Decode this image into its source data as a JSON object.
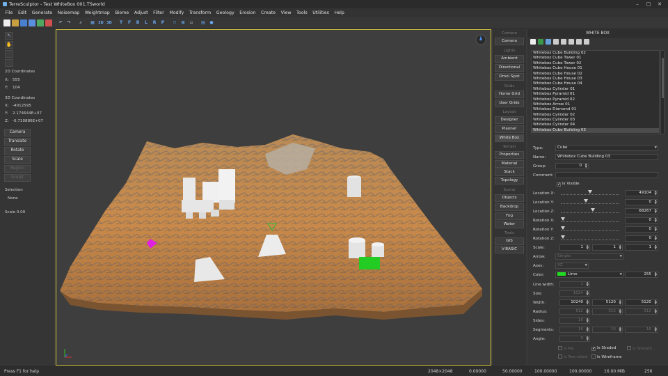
{
  "window": {
    "title": "TerreSculptor - Test WhiteBox 001.TSworld",
    "minimize": "–",
    "maximize": "□",
    "close": "✕"
  },
  "menu": [
    "File",
    "Edit",
    "Generate",
    "Noisemap",
    "Weightmap",
    "Biome",
    "Adjust",
    "Filter",
    "Modify",
    "Transform",
    "Geology",
    "Erosion",
    "Create",
    "View",
    "Tools",
    "Utilities",
    "Help"
  ],
  "toolbar": {
    "icons": [
      "new-file-icon",
      "open-icon",
      "save-icon",
      "save-as-icon",
      "import-icon",
      "export-icon",
      "undo-icon",
      "redo-icon",
      "zoom-icon",
      "grid-icon",
      "view-3d-icon",
      "view-3d-alt-icon",
      "top-view-icon",
      "front-view-icon",
      "back-view-icon",
      "left-view-icon",
      "right-view-icon",
      "perspective-view-icon",
      "snap-icon",
      "layout-icon",
      "wireframe-icon",
      "layers-icon",
      "globe-icon"
    ],
    "letters": [
      "T",
      "F",
      "B",
      "L",
      "R",
      "P"
    ]
  },
  "left": {
    "coords2d_label": "2D Coordinates",
    "x_label": "X:",
    "x_value": "555",
    "y_label": "Y:",
    "y_value": "104",
    "coords3d_label": "3D Coordinates",
    "x3_label": "X:",
    "x3_value": "-4012595",
    "y3_label": "Y:",
    "y3_value": "2.174644E+07",
    "z3_label": "Z:",
    "z3_value": "-6.710886E+07",
    "buttons": [
      "Camera",
      "Translate",
      "Rotate",
      "Scale",
      "Region",
      "Sculpt"
    ],
    "selection_label": "Selection",
    "selection_value": "None",
    "scale_text": "Scale 0.00"
  },
  "middle": {
    "camera_header": "Camera",
    "camera_btn": "Camera",
    "lights_header": "Lights",
    "ambient_btn": "Ambient",
    "directional_btn": "Directional",
    "omni_btn": "Omni Spot",
    "grids_header": "Grids",
    "home_grid_btn": "Home Grid",
    "user_grids_btn": "User Grids",
    "layout_header": "Layout",
    "designer_btn": "Designer",
    "planner_btn": "Planner",
    "whitebox_btn": "White Box",
    "terrain_header": "Terrain",
    "properties_btn": "Properties",
    "material_btn": "Material",
    "stack_btn": "Stack",
    "topology_btn": "Topology",
    "scene_header": "Scene",
    "objects_btn": "Objects",
    "backdrop_btn": "Backdrop",
    "fog_btn": "Fog",
    "water_btn": "Water",
    "tools_header": "Tools",
    "gis_btn": "GIS",
    "vbasic_btn": "V-BASIC"
  },
  "right": {
    "title": "WHITE BOX",
    "objects": [
      "Whitebox Cube Building 02",
      "Whitebox Cube Tower 01",
      "Whitebox Cube Tower 02",
      "Whitebox Cube House 01",
      "Whitebox Cube House 02",
      "Whitebox Cube House 03",
      "Whitebox Cube House 04",
      "Whitebox Cylinder 01",
      "Whitebox Pyramid 01",
      "Whitebox Pyramid 02",
      "Whitebox Arrow 01",
      "Whitebox Diamond 01",
      "Whitebox Cylinder 02",
      "Whitebox Cylinder 03",
      "Whitebox Cylinder 04",
      "Whitebox Cube Building 03"
    ],
    "type_label": "Type:",
    "type_value": "Cube",
    "name_label": "Name:",
    "name_value": "Whitebox Cube Building 03",
    "group_label": "Group:",
    "group_value": "0",
    "comment_label": "Comment:",
    "comment_value": "",
    "visible_label": "Is Visible",
    "locx_label": "Location X:",
    "locx_value": "49104",
    "locy_label": "Location Y:",
    "locy_value": "0",
    "locz_label": "Location Z:",
    "locz_value": "68267",
    "rotx_label": "Rotation X:",
    "rotx_value": "0",
    "roty_label": "Rotation Y:",
    "roty_value": "0",
    "rotz_label": "Rotation Z:",
    "rotz_value": "0",
    "sliders": {
      "locx": 0.5,
      "locy": 0.42,
      "locz": 0.55,
      "rotx": 0,
      "roty": 0,
      "rotz": 0
    },
    "scale_label": "Scale:",
    "scale_values": [
      "1",
      "1",
      "1"
    ],
    "arrow_label": "Arrow:",
    "arrow_value": "Simple",
    "axes_label": "Axes:",
    "axes_value": "XZ",
    "color_label": "Color:",
    "color_value": "Lime",
    "color_swatch": "#22dd22",
    "alpha_value": "255",
    "linewidth_label": "Line width:",
    "linewidth_value": "1",
    "size_label": "Size:",
    "size_value": "1024",
    "width_label": "Width:",
    "width_values": [
      "10240",
      "5120",
      "5120"
    ],
    "radius_label": "Radius:",
    "radius_values": [
      "512",
      "512",
      "512"
    ],
    "sides_label": "Sides:",
    "sides_value": "16",
    "segments_label": "Segments:",
    "segments_values": [
      "16",
      "16",
      "16"
    ],
    "angle_label": "Angle:",
    "angle_value": "0",
    "is_pie": "Is Pie",
    "is_shaded": "Is Shaded",
    "is_smooth": "Is Smooth",
    "is_two_sided": "Is Two-sided",
    "is_wireframe": "Is Wireframe"
  },
  "status": {
    "help": "Press F1 for help",
    "res": "2048×2048",
    "v1": "0.00000",
    "v2": "50.00000",
    "v3": "100.00000",
    "v4": "100.00000",
    "mem": "16.00 MiB",
    "n": "256"
  },
  "colors": {
    "viewport_border": "#d4c43c",
    "terrain": "#c98a4a",
    "selected_object": "#22cc22",
    "arrow_marker": "#e020e0"
  }
}
